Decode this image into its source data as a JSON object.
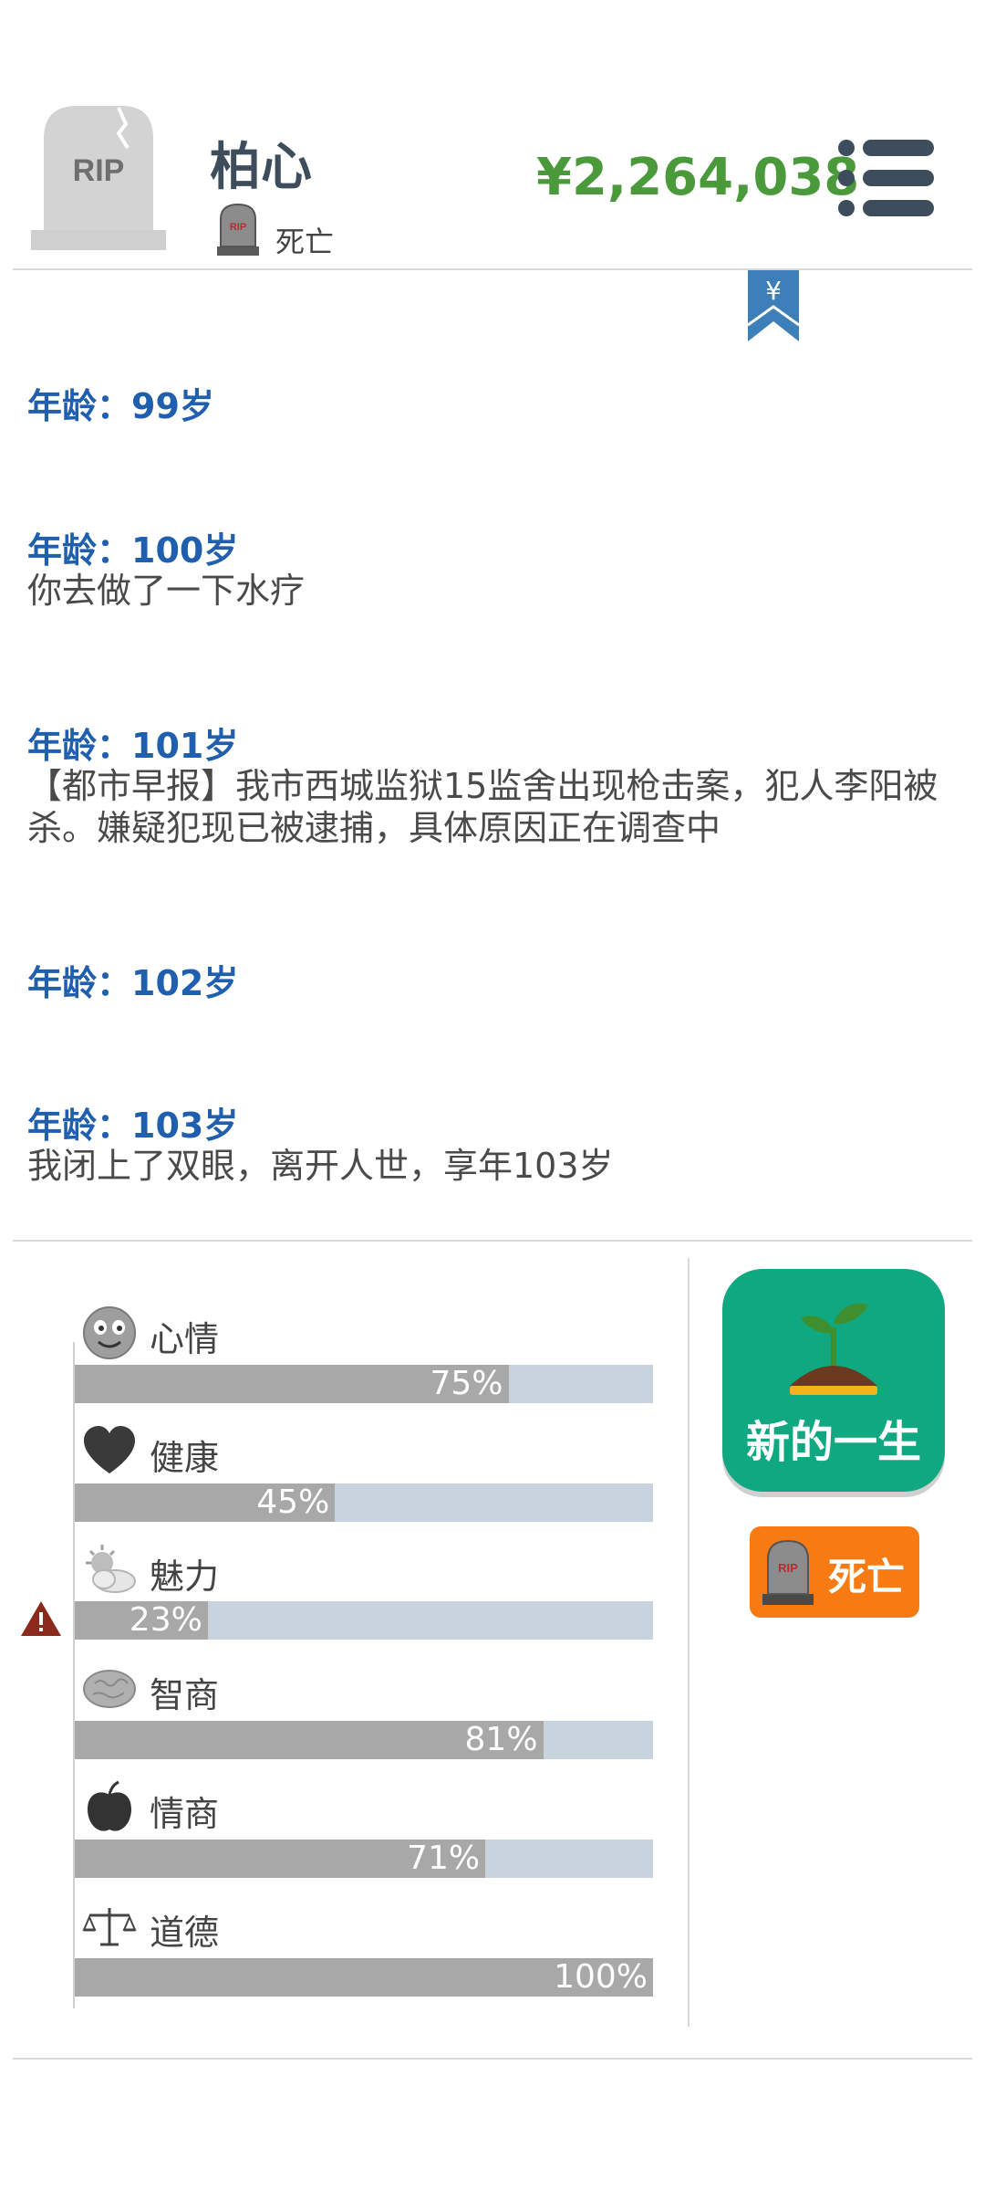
{
  "header": {
    "avatar_text": "RIP",
    "name": "柏心",
    "status_icon_text": "RIP",
    "status": "死亡",
    "money": "¥2,264,038",
    "menu_icon": "list-menu-icon",
    "bookmark_symbol": "¥"
  },
  "log": [
    {
      "age": "年龄：99岁",
      "text": ""
    },
    {
      "age": "年龄：100岁",
      "text": "你去做了一下水疗"
    },
    {
      "age": "年龄：101岁",
      "text": "【都市早报】我市西城监狱15监舍出现枪击案，犯人李阳被杀。嫌疑犯现已被逮捕，具体原因正在调查中"
    },
    {
      "age": "年龄：102岁",
      "text": ""
    },
    {
      "age": "年龄：103岁",
      "text": "我闭上了双眼，离开人世，享年103岁"
    }
  ],
  "stats": [
    {
      "label": "心情",
      "value": 0.75,
      "pct": "75%",
      "icon": "smiley-face-icon"
    },
    {
      "label": "健康",
      "value": 0.45,
      "pct": "45%",
      "icon": "heart-icon"
    },
    {
      "label": "魅力",
      "value": 0.23,
      "pct": "23%",
      "icon": "sun-cloud-icon",
      "warning": true
    },
    {
      "label": "智商",
      "value": 0.81,
      "pct": "81%",
      "icon": "brain-icon"
    },
    {
      "label": "情商",
      "value": 0.71,
      "pct": "71%",
      "icon": "apple-icon"
    },
    {
      "label": "道德",
      "value": 1.0,
      "pct": "100%",
      "icon": "scales-icon"
    }
  ],
  "buttons": {
    "new_life": "新的一生",
    "death": "死亡",
    "death_icon_text": "RIP"
  },
  "colors": {
    "accent_green": "#10a880",
    "money_green": "#4a9a3b",
    "age_blue": "#1f5fae",
    "death_orange": "#f77a12",
    "bar_fill": "#a8a8a8",
    "bar_track": "#c9d3de"
  }
}
